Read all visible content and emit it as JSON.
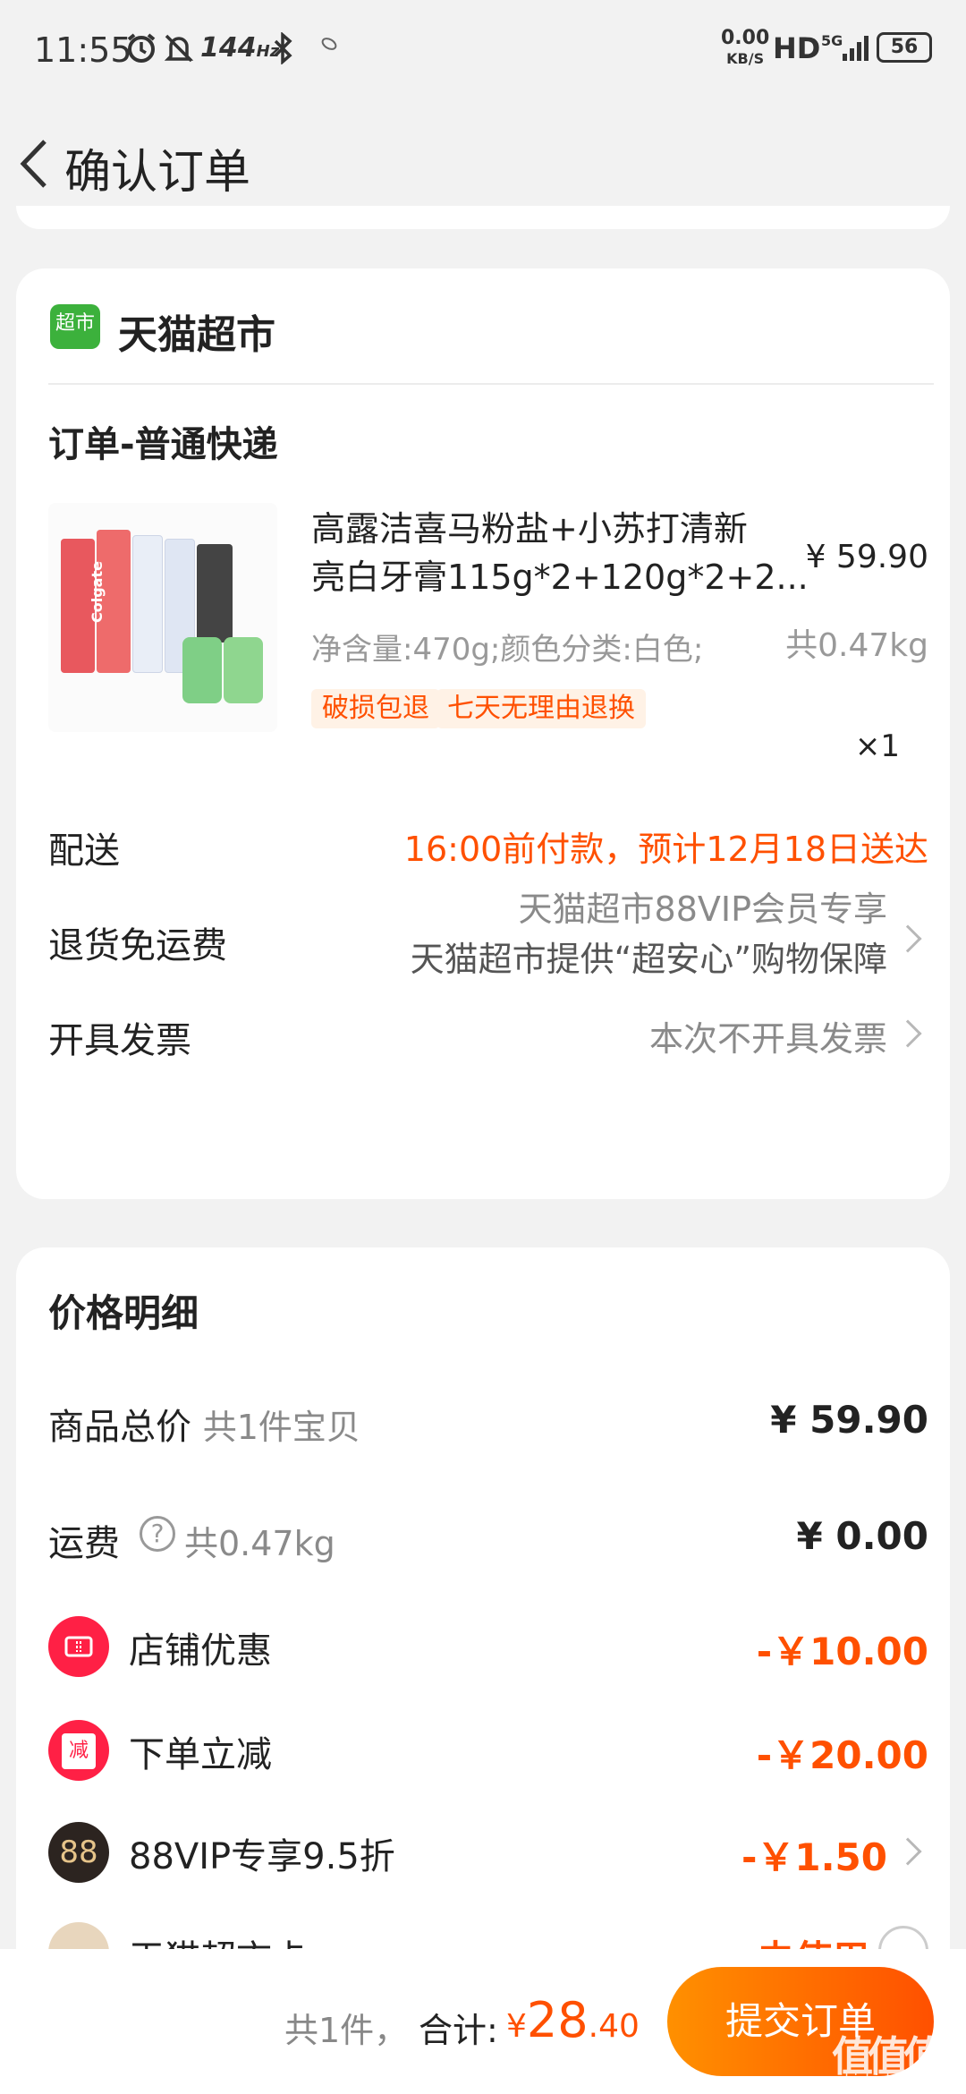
{
  "status_bar": {
    "time": "11:55",
    "refresh_rate": "144",
    "refresh_unit": "Hz",
    "net_speed": "0.00",
    "net_unit": "KB/S",
    "hd": "HD",
    "signal": "5G",
    "battery": "56"
  },
  "header": {
    "title": "确认订单"
  },
  "store": {
    "badge": "超市",
    "name": "天猫超市",
    "order_type": "订单-普通快递"
  },
  "product": {
    "title_line1": "高露洁喜马粉盐+小苏打清新",
    "title_line2": "亮白牙膏115g*2+120g*2+2...",
    "price": "¥ 59.90",
    "spec": "净含量:470g;颜色分类:白色;",
    "weight": "共0.47kg",
    "tags": [
      "破损包退",
      "七天无理由退换"
    ],
    "quantity": "×1",
    "image_label": "Colgate"
  },
  "delivery": {
    "label": "配送",
    "value": "16:00前付款，预计12月18日送达"
  },
  "return_shipping": {
    "label": "退货免运费",
    "line1": "天猫超市88VIP会员专享",
    "line2": "天猫超市提供“超安心”购物保障"
  },
  "invoice": {
    "label": "开具发票",
    "value": "本次不开具发票"
  },
  "price_detail": {
    "title": "价格明细",
    "goods_total_label": "商品总价",
    "goods_total_sub": "共1件宝贝",
    "goods_total_value": "¥ 59.90",
    "shipping_label": "运费",
    "shipping_sub": "共0.47kg",
    "shipping_value": "¥ 0.00",
    "store_discount_label": "店铺优惠",
    "store_discount_value": "-￥10.00",
    "instant_discount_label": "下单立减",
    "instant_discount_icon": "减",
    "instant_discount_value": "-￥20.00",
    "vip_label": "88VIP专享9.5折",
    "vip_icon": "88",
    "vip_value": "-￥1.50",
    "card_label": "天猫超市卡",
    "card_value": "未使用"
  },
  "bottom": {
    "count": "共1件，",
    "total_label": "合计:",
    "currency": "¥",
    "total_int": "28",
    "total_dec": ".40",
    "submit": "提交订单",
    "watermark": "值",
    "watermark_url": "zhizhizhi.com"
  },
  "colors": {
    "accent": "#ff5000",
    "background": "#f2f2f2",
    "tmall_green": "#3cb13c"
  }
}
